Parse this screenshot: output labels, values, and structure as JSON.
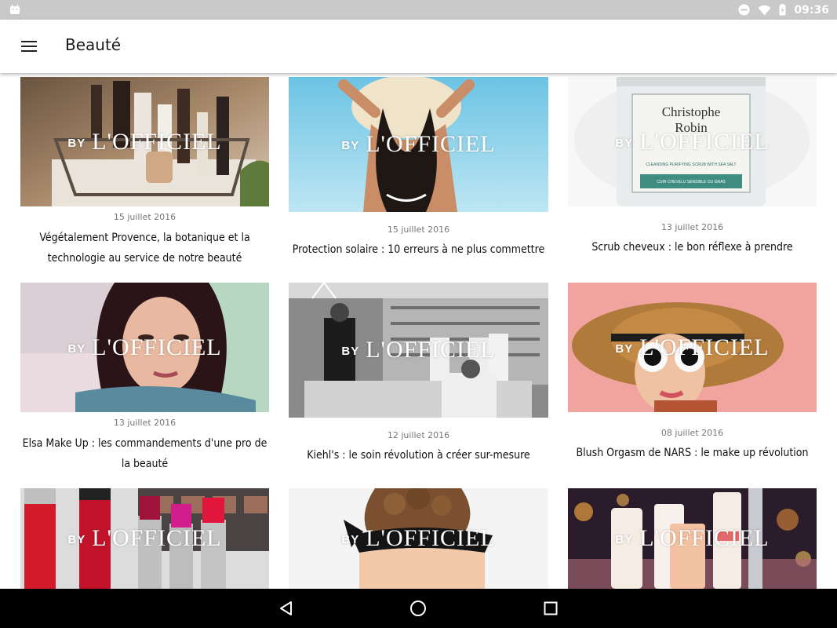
{
  "status_bar": {
    "time": "09:36",
    "icons": [
      "android-icon",
      "dnd-icon",
      "wifi-icon",
      "battery-icon"
    ]
  },
  "app_bar": {
    "title": "Beauté",
    "menu_icon": "hamburger-menu-icon"
  },
  "logo": {
    "by": "BY",
    "brand": "L'OFFICIEL"
  },
  "articles": [
    {
      "date": "15 juillet 2016",
      "title": "Végétalement Provence, la botanique et la technologie au service de notre beauté"
    },
    {
      "date": "15 juillet 2016",
      "title": "Protection solaire : 10 erreurs à ne plus commettre"
    },
    {
      "date": "13 juillet 2016",
      "title": "Scrub cheveux : le bon réflexe à prendre"
    },
    {
      "date": "13 juillet 2016",
      "title": "Elsa Make Up : les commandements d'une pro de la beauté"
    },
    {
      "date": "12 juillet 2016",
      "title": "Kiehl's : le soin révolution à créer sur-mesure"
    },
    {
      "date": "08 juillet 2016",
      "title": "Blush Orgasm de NARS : le make up révolution"
    },
    {
      "date": "",
      "title": ""
    },
    {
      "date": "",
      "title": ""
    },
    {
      "date": "",
      "title": ""
    }
  ],
  "product_labels": {
    "jar_brand": "Christophe Robin",
    "jar_line1": "CLEANSING PURIFYING SCRUB WITH SEA SALT",
    "jar_line2": "CUIR CHEVELU SENSIBLE OU GRAS"
  },
  "nav_bar": {
    "icons": [
      "back-icon",
      "home-icon",
      "recents-icon"
    ]
  },
  "colors": {
    "status_bar": "#c9c9c9",
    "nav_bar": "#000000",
    "background": "#ffffff"
  }
}
